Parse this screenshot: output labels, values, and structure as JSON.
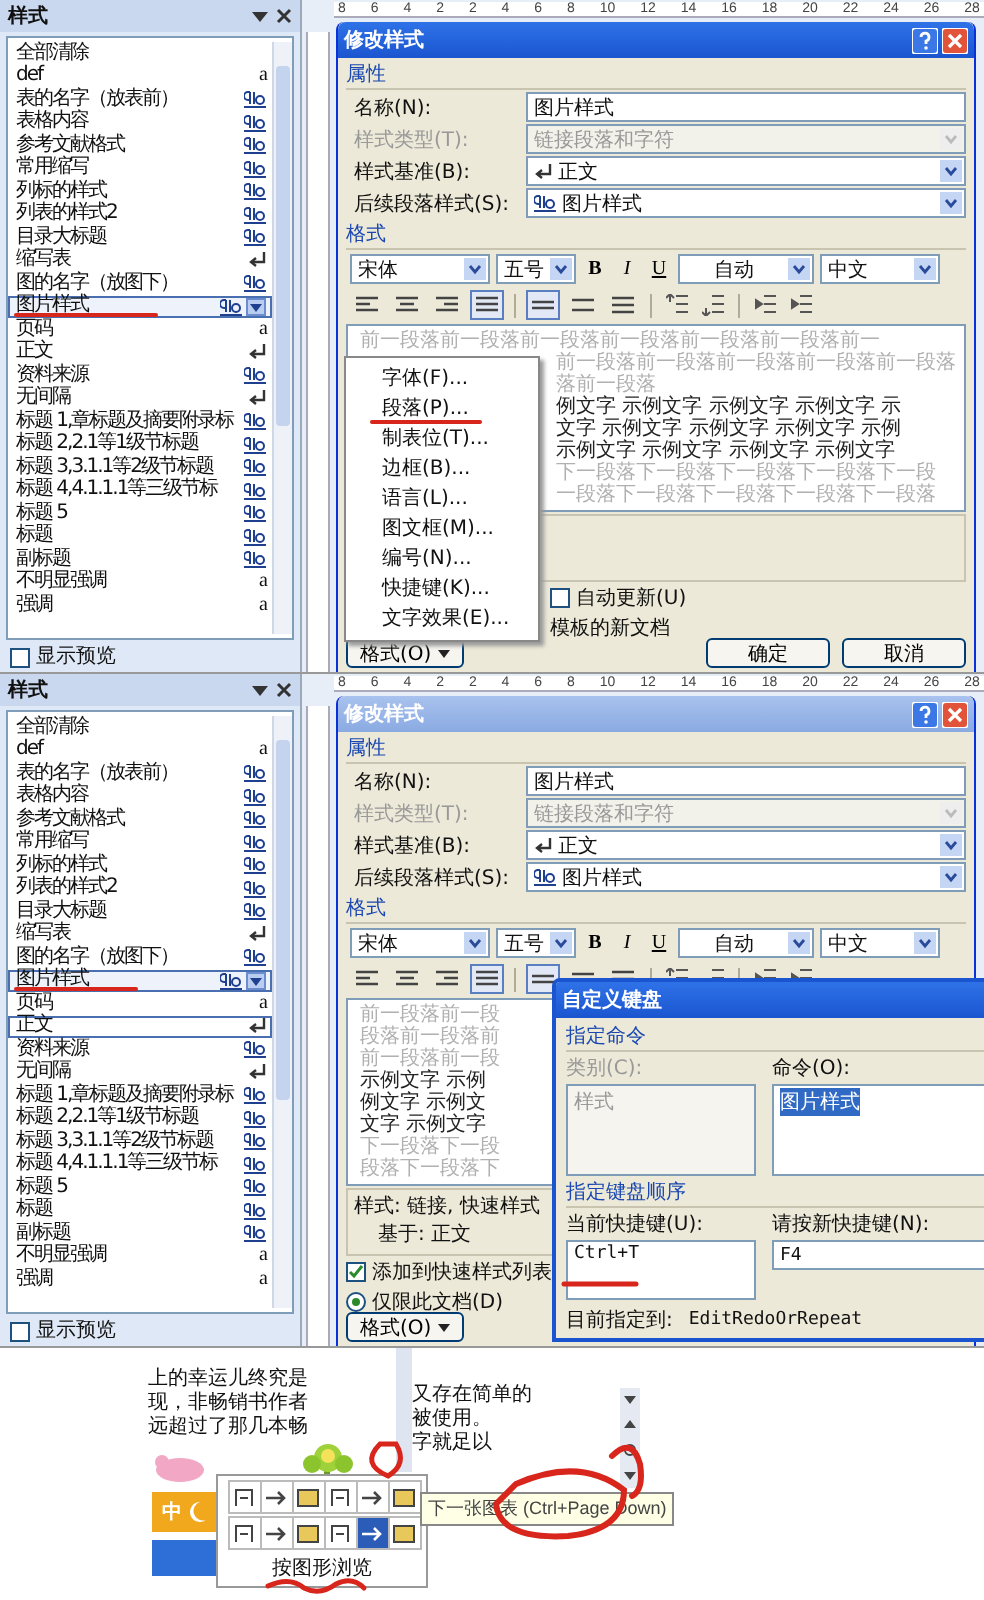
{
  "panes": [
    {
      "styles_panel": {
        "title": "样式",
        "items": [
          {
            "label": "全部清除",
            "kind": "plain",
            "selected": false,
            "outlined": false
          },
          {
            "label": "def",
            "kind": "char",
            "mark": "a",
            "selected": false,
            "outlined": false
          },
          {
            "label": "表的名字（放表前）",
            "kind": "linked",
            "selected": false,
            "outlined": false
          },
          {
            "label": "表格内容",
            "kind": "linked",
            "selected": false,
            "outlined": false
          },
          {
            "label": "参考文献格式",
            "kind": "linked",
            "selected": false,
            "outlined": false
          },
          {
            "label": "常用缩写",
            "kind": "linked",
            "selected": false,
            "outlined": false
          },
          {
            "label": "列标的样式",
            "kind": "linked",
            "selected": false,
            "outlined": false
          },
          {
            "label": "列表的样式2",
            "kind": "linked",
            "selected": false,
            "outlined": false
          },
          {
            "label": "目录大标题",
            "kind": "linked",
            "selected": false,
            "outlined": false
          },
          {
            "label": "缩写表",
            "kind": "para",
            "selected": false,
            "outlined": false
          },
          {
            "label": "图的名字（放图下）",
            "kind": "linked",
            "selected": false,
            "outlined": false
          },
          {
            "label": "图片样式",
            "kind": "linked",
            "selected": true,
            "outlined": false
          },
          {
            "label": "页码",
            "kind": "char",
            "mark": "a",
            "selected": false,
            "outlined": false
          },
          {
            "label": "正文",
            "kind": "para",
            "selected": false,
            "outlined": false
          },
          {
            "label": "资料来源",
            "kind": "linked",
            "selected": false,
            "outlined": false
          },
          {
            "label": "无间隔",
            "kind": "para",
            "selected": false,
            "outlined": false
          },
          {
            "label": "标题 1,章标题及摘要附录标",
            "kind": "linked",
            "selected": false,
            "outlined": false
          },
          {
            "label": "标题 2,2.1等1级节标题",
            "kind": "linked",
            "selected": false,
            "outlined": false
          },
          {
            "label": "标题 3,3.1.1等2级节标题",
            "kind": "linked",
            "selected": false,
            "outlined": false
          },
          {
            "label": "标题 4,4.1.1.1等三级节标",
            "kind": "linked",
            "selected": false,
            "outlined": false
          },
          {
            "label": "标题 5",
            "kind": "linked",
            "selected": false,
            "outlined": false
          },
          {
            "label": "标题",
            "kind": "linked",
            "selected": false,
            "outlined": false
          },
          {
            "label": "副标题",
            "kind": "linked",
            "selected": false,
            "outlined": false
          },
          {
            "label": "不明显强调",
            "kind": "char",
            "mark": "a",
            "selected": false,
            "outlined": false
          },
          {
            "label": "强调",
            "kind": "char",
            "mark": "a",
            "selected": false,
            "outlined": false
          }
        ],
        "footer": [
          {
            "label": "显示预览",
            "checked": false
          }
        ]
      },
      "ruler": [
        "8",
        "6",
        "4",
        "2",
        "2",
        "4",
        "6",
        "8",
        "10",
        "12",
        "14",
        "16",
        "18",
        "20",
        "22",
        "24",
        "26",
        "28"
      ],
      "dialog": {
        "title": "修改样式",
        "active": true,
        "properties_heading": "属性",
        "fields": [
          {
            "label": "名称(N):",
            "value": "图片样式",
            "kind": "text",
            "disabled": false
          },
          {
            "label": "样式类型(T):",
            "value": "链接段落和字符",
            "kind": "select",
            "disabled": true
          },
          {
            "label": "样式基准(B):",
            "value": "正文",
            "kind": "paragraph",
            "disabled": false
          },
          {
            "label": "后续段落样式(S):",
            "value": "图片样式",
            "kind": "linked",
            "disabled": false
          }
        ],
        "format_heading": "格式",
        "font": "宋体",
        "size": "五号",
        "text_buttons": [
          "B",
          "I",
          "U"
        ],
        "font_color": "自动",
        "script": "中文",
        "alignment": [
          {
            "selected": false
          },
          {
            "selected": false
          },
          {
            "selected": false
          },
          {
            "selected": true
          }
        ],
        "spacing": [
          {
            "selected": true
          },
          {
            "selected": false
          },
          {
            "selected": false
          }
        ],
        "preview": [
          {
            "text": "前一段落前一段落前一段落前一段落前一段落前一段落前一",
            "kind": "previous",
            "cut": false
          },
          {
            "text": "前一段落前一段落前一段落前一段落前一段落",
            "kind": "previous",
            "cut": true
          },
          {
            "text": "落前一段落",
            "kind": "previous",
            "cut": true
          },
          {
            "text": "例文字 示例文字 示例文字 示例文字 示",
            "kind": "sample",
            "cut": true
          },
          {
            "text": "文字 示例文字 示例文字 示例文字 示例",
            "kind": "sample",
            "cut": true
          },
          {
            "text": "示例文字 示例文字 示例文字 示例文字",
            "kind": "sample",
            "cut": true
          },
          {
            "text": "下一段落下一段落下一段落下一段落下一段",
            "kind": "next",
            "cut": true
          },
          {
            "text": "一段落下一段落下一段落下一段落下一段落",
            "kind": "next",
            "cut": true
          }
        ],
        "options": [
          {
            "kind": "checkbox",
            "label": "自动更新(U)",
            "checked": false,
            "cut": true
          },
          {
            "kind": "text",
            "label": "模板的新文档",
            "cut": true
          }
        ],
        "buttons": [
          {
            "kind": "menu",
            "label": "格式(O)"
          },
          {
            "kind": "ok",
            "label": "确定"
          },
          {
            "kind": "cancel",
            "label": "取消"
          }
        ]
      },
      "overlay": {
        "kind": "format_menu",
        "items": [
          "字体(F)...",
          "段落(P)...",
          "制表位(T)...",
          "边框(B)...",
          "语言(L)...",
          "图文框(M)...",
          "编号(N)...",
          "快捷键(K)...",
          "文字效果(E)..."
        ]
      }
    },
    {
      "styles_panel": {
        "title": "样式",
        "items": [
          {
            "label": "全部清除",
            "kind": "plain",
            "selected": false,
            "outlined": false
          },
          {
            "label": "def",
            "kind": "char",
            "mark": "a",
            "selected": false,
            "outlined": false
          },
          {
            "label": "表的名字（放表前）",
            "kind": "linked",
            "selected": false,
            "outlined": false
          },
          {
            "label": "表格内容",
            "kind": "linked",
            "selected": false,
            "outlined": false
          },
          {
            "label": "参考文献格式",
            "kind": "linked",
            "selected": false,
            "outlined": false
          },
          {
            "label": "常用缩写",
            "kind": "linked",
            "selected": false,
            "outlined": false
          },
          {
            "label": "列标的样式",
            "kind": "linked",
            "selected": false,
            "outlined": false
          },
          {
            "label": "列表的样式2",
            "kind": "linked",
            "selected": false,
            "outlined": false
          },
          {
            "label": "目录大标题",
            "kind": "linked",
            "selected": false,
            "outlined": false
          },
          {
            "label": "缩写表",
            "kind": "para",
            "selected": false,
            "outlined": false
          },
          {
            "label": "图的名字（放图下）",
            "kind": "linked",
            "selected": false,
            "outlined": false
          },
          {
            "label": "图片样式",
            "kind": "linked",
            "selected": true,
            "outlined": false
          },
          {
            "label": "页码",
            "kind": "char",
            "mark": "a",
            "selected": false,
            "outlined": false
          },
          {
            "label": "正文",
            "kind": "para",
            "selected": false,
            "outlined": true
          },
          {
            "label": "资料来源",
            "kind": "linked",
            "selected": false,
            "outlined": false
          },
          {
            "label": "无间隔",
            "kind": "para",
            "selected": false,
            "outlined": false
          },
          {
            "label": "标题 1,章标题及摘要附录标",
            "kind": "linked",
            "selected": false,
            "outlined": false
          },
          {
            "label": "标题 2,2.1等1级节标题",
            "kind": "linked",
            "selected": false,
            "outlined": false
          },
          {
            "label": "标题 3,3.1.1等2级节标题",
            "kind": "linked",
            "selected": false,
            "outlined": false
          },
          {
            "label": "标题 4,4.1.1.1等三级节标",
            "kind": "linked",
            "selected": false,
            "outlined": false
          },
          {
            "label": "标题 5",
            "kind": "linked",
            "selected": false,
            "outlined": false
          },
          {
            "label": "标题",
            "kind": "linked",
            "selected": false,
            "outlined": false
          },
          {
            "label": "副标题",
            "kind": "linked",
            "selected": false,
            "outlined": false
          },
          {
            "label": "不明显强调",
            "kind": "char",
            "mark": "a",
            "selected": false,
            "outlined": false
          },
          {
            "label": "强调",
            "kind": "char",
            "mark": "a",
            "selected": false,
            "outlined": false
          }
        ],
        "footer": [
          {
            "label": "显示预览",
            "checked": false
          }
        ]
      },
      "ruler": [
        "8",
        "6",
        "4",
        "2",
        "2",
        "4",
        "6",
        "8",
        "10",
        "12",
        "14",
        "16",
        "18",
        "20",
        "22",
        "24",
        "26",
        "28"
      ],
      "dialog": {
        "title": "修改样式",
        "active": false,
        "properties_heading": "属性",
        "fields": [
          {
            "label": "名称(N):",
            "value": "图片样式",
            "kind": "text",
            "disabled": false
          },
          {
            "label": "样式类型(T):",
            "value": "链接段落和字符",
            "kind": "select",
            "disabled": true
          },
          {
            "label": "样式基准(B):",
            "value": "正文",
            "kind": "paragraph",
            "disabled": false
          },
          {
            "label": "后续段落样式(S):",
            "value": "图片样式",
            "kind": "linked",
            "disabled": false
          }
        ],
        "format_heading": "格式",
        "font": "宋体",
        "size": "五号",
        "text_buttons": [
          "B",
          "I",
          "U"
        ],
        "font_color": "自动",
        "script": "中文",
        "alignment": [
          {
            "selected": false
          },
          {
            "selected": false
          },
          {
            "selected": false
          },
          {
            "selected": true
          }
        ],
        "spacing": [
          {
            "selected": true
          },
          {
            "selected": false
          },
          {
            "selected": false
          }
        ],
        "preview": [
          {
            "text": "前一段落前一段",
            "kind": "previous",
            "cut": false
          },
          {
            "text": "段落前一段落前",
            "kind": "previous",
            "cut": false
          },
          {
            "text": "前一段落前一段",
            "kind": "previous",
            "cut": false
          },
          {
            "text": "示例文字 示例",
            "kind": "sample",
            "cut": false
          },
          {
            "text": "例文字 示例文",
            "kind": "sample",
            "cut": false
          },
          {
            "text": "文字 示例文字",
            "kind": "sample",
            "cut": false
          },
          {
            "text": "下一段落下一段",
            "kind": "next",
            "cut": false
          },
          {
            "text": "段落下一段落下",
            "kind": "next",
            "cut": false
          }
        ],
        "description": [
          "样式: 链接, 快速样式",
          "基于: 正文"
        ],
        "options": [
          {
            "kind": "checkbox",
            "label": "添加到快速样式列表",
            "checked": true,
            "cut": false
          },
          {
            "kind": "radio",
            "label": "仅限此文档(D)",
            "selected": true,
            "cut": false
          }
        ],
        "buttons": [
          {
            "kind": "menu",
            "label": "格式(O)"
          }
        ]
      },
      "overlay": {
        "kind": "keyboard_dialog",
        "title": "自定义键盘",
        "command_heading": "指定命令",
        "category_label": "类别(C):",
        "categories": [
          "样式"
        ],
        "command_label": "命令(O):",
        "commands": [
          {
            "label": "图片样式",
            "selected": true
          }
        ],
        "keys_heading": "指定键盘顺序",
        "current_label": "当前快捷键(U):",
        "current_keys": [
          "Ctrl+T"
        ],
        "new_label": "请按新快捷键(N):",
        "new_key": "F4",
        "assigned_label": "目前指定到:",
        "assigned_value": "EditRedoOrRepeat"
      }
    }
  ],
  "document": {
    "left_text": [
      "上的幸运儿终究是",
      "现，非畅销书作者",
      "远超过了那几本畅"
    ],
    "ime": "中",
    "right_text": [
      "又存在简单的",
      "被使用。",
      "字就足以"
    ],
    "browse_label": "按图形浏览",
    "browse_buttons": [
      {
        "selected": false
      },
      {
        "selected": false
      },
      {
        "selected": false
      },
      {
        "selected": false
      },
      {
        "selected": false
      },
      {
        "selected": false
      },
      {
        "selected": false
      },
      {
        "selected": false
      },
      {
        "selected": false
      },
      {
        "selected": false
      },
      {
        "selected": true
      },
      {
        "selected": false
      }
    ],
    "tooltip": "下一张图表 (Ctrl+Page Down)"
  }
}
